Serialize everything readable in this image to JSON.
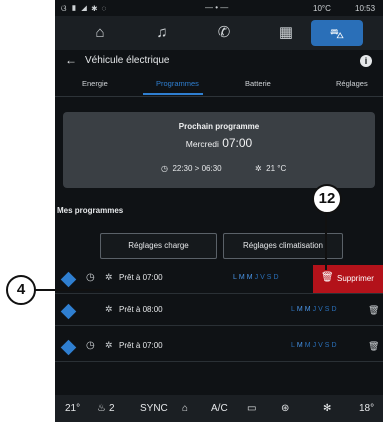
{
  "status_bar": {
    "icons": "ଓ ▮ ◢ ✱ ◌",
    "middle": "— • —",
    "temperature": "10°C",
    "time": "10:53"
  },
  "nav": {
    "icons": [
      "home-icon",
      "music-icon",
      "phone-icon",
      "apps-icon",
      "car-icon"
    ]
  },
  "header": {
    "back_icon": "←",
    "title": "Véhicule électrique",
    "info_icon": "i"
  },
  "tabs": [
    {
      "label": "Energie"
    },
    {
      "label": "Programmes"
    },
    {
      "label": "Batterie"
    },
    {
      "label": "Réglages"
    }
  ],
  "next_program": {
    "title": "Prochain programme",
    "day": "Mercredi",
    "time": "07:00",
    "range": "22:30 > 06:30",
    "temperature": "21 °C"
  },
  "programs_section": {
    "title": "Mes programmes"
  },
  "buttons": {
    "charge": "Réglages charge",
    "climate": "Réglages climatisation"
  },
  "programs": [
    {
      "label": "Prêt à 07:00",
      "days": [
        "L",
        "M",
        "M",
        "J",
        "V",
        "S",
        "D"
      ],
      "active_days": [
        0,
        1,
        2
      ]
    },
    {
      "label": "Prêt à 08:00",
      "days": [
        "L",
        "M",
        "M",
        "J",
        "V",
        "S",
        "D"
      ],
      "active_days": [
        1,
        2
      ]
    },
    {
      "label": "Prêt à 07:00",
      "days": [
        "L",
        "M",
        "M",
        "J",
        "V",
        "S",
        "D"
      ],
      "active_days": [
        1
      ]
    }
  ],
  "delete_label": "Supprimer",
  "bottom_bar": {
    "left_temp": "21°",
    "seat": "2",
    "sync": "SYNC",
    "ac": "A/C",
    "right_temp": "18°"
  },
  "callouts": {
    "left": "4",
    "top": "12"
  },
  "colors": {
    "accent": "#2f7fd1",
    "delete": "#b3121a",
    "background": "#0f1215"
  }
}
